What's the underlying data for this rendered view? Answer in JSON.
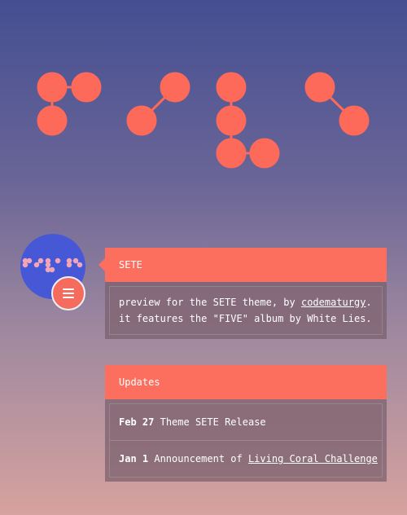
{
  "logo": {
    "name": "FIVE",
    "dot_color": "#fe6a5a"
  },
  "avatar": {
    "dot_color": "#f0a5b8",
    "bg_color": "#4758d6"
  },
  "about": {
    "title": "SETE",
    "line1_prefix": "preview for the SETE theme, by ",
    "author": "codematurgy",
    "line1_suffix": ".",
    "line2": "it features the \"FIVE\" album by White Lies."
  },
  "updates": {
    "title": "Updates",
    "items": [
      {
        "date": "Feb 27",
        "text": "Theme SETE Release",
        "link": ""
      },
      {
        "date": "Jan 1",
        "text": "Announcement of ",
        "link": "Living Coral Challenge"
      }
    ]
  },
  "colors": {
    "accent": "#fc6f5f",
    "bg_top": "#444f92",
    "bg_bottom": "#d6a29f"
  }
}
